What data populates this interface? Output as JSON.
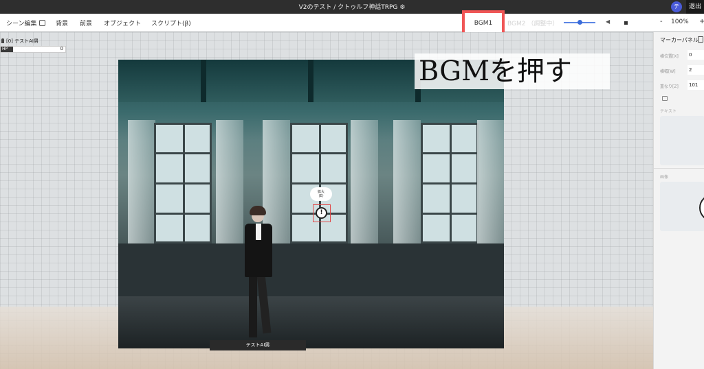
{
  "titlebar": {
    "title": "V2のテスト / クトゥルフ神話TRPG",
    "gear_icon": "gear-icon",
    "avatar_initial": "テ",
    "exit_label": "退出"
  },
  "toolbar": {
    "scene_edit": "シーン編集",
    "background": "背景",
    "foreground": "前景",
    "object": "オブジェクト",
    "script": "スクリプト(β)",
    "bgm1": "BGM1",
    "bgm2": "BGM2 （調整中）",
    "volume_level_percent": 60,
    "play_icon": "play-icon",
    "stop_icon": "stop-icon",
    "zoom_minus": "-",
    "zoom_value": "100%",
    "zoom_plus": "+"
  },
  "highlight_color": "#f05656",
  "character_status": {
    "name": "[0] テストAI男",
    "hp_label": "HP",
    "hp_value": "0"
  },
  "scene": {
    "speech_bubble_text": "拡大\n(E)",
    "marker_symbol": "!",
    "character_name": "テストAI男"
  },
  "annotation": {
    "text": "BGMを押す"
  },
  "panel": {
    "title": "マーカーパネル",
    "fields": [
      {
        "label": "横位置[X]",
        "value": "0"
      },
      {
        "label": "横幅[W]",
        "value": "2"
      },
      {
        "label": "重なり[Z]",
        "value": "101"
      }
    ],
    "text_label": "テキスト",
    "image_label": "画像"
  }
}
